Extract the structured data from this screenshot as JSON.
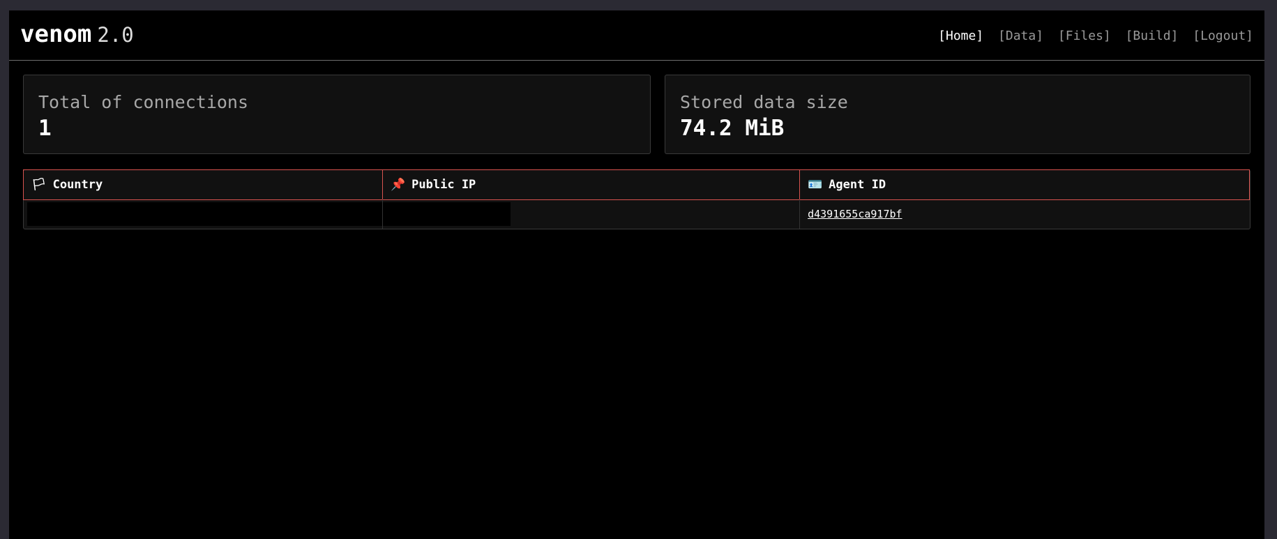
{
  "brand": {
    "name": "venom",
    "version": "2.0"
  },
  "nav": {
    "items": [
      {
        "label": "[Home]"
      },
      {
        "label": "[Data]"
      },
      {
        "label": "[Files]"
      },
      {
        "label": "[Build]"
      },
      {
        "label": "[Logout]"
      }
    ],
    "active": "[Home]"
  },
  "stats": {
    "connections": {
      "label": "Total of connections",
      "value": "1"
    },
    "storage": {
      "label": "Stored data size",
      "value": "74.2 MiB"
    }
  },
  "table": {
    "columns": [
      {
        "icon": "flag-icon",
        "glyph": "🏳",
        "label": "Country"
      },
      {
        "icon": "pushpin-icon",
        "glyph": "📌",
        "label": "Public IP"
      },
      {
        "icon": "id-card-icon",
        "glyph": "🪪",
        "label": "Agent ID"
      }
    ],
    "rows": [
      {
        "country": "",
        "public_ip": "",
        "agent_id": "d4391655ca917bf"
      }
    ]
  },
  "colors": {
    "background": "#000000",
    "card_background": "#111111",
    "table_header_border": "#d9534f",
    "text_primary": "#ffffff",
    "text_muted": "#9a9a9a"
  }
}
